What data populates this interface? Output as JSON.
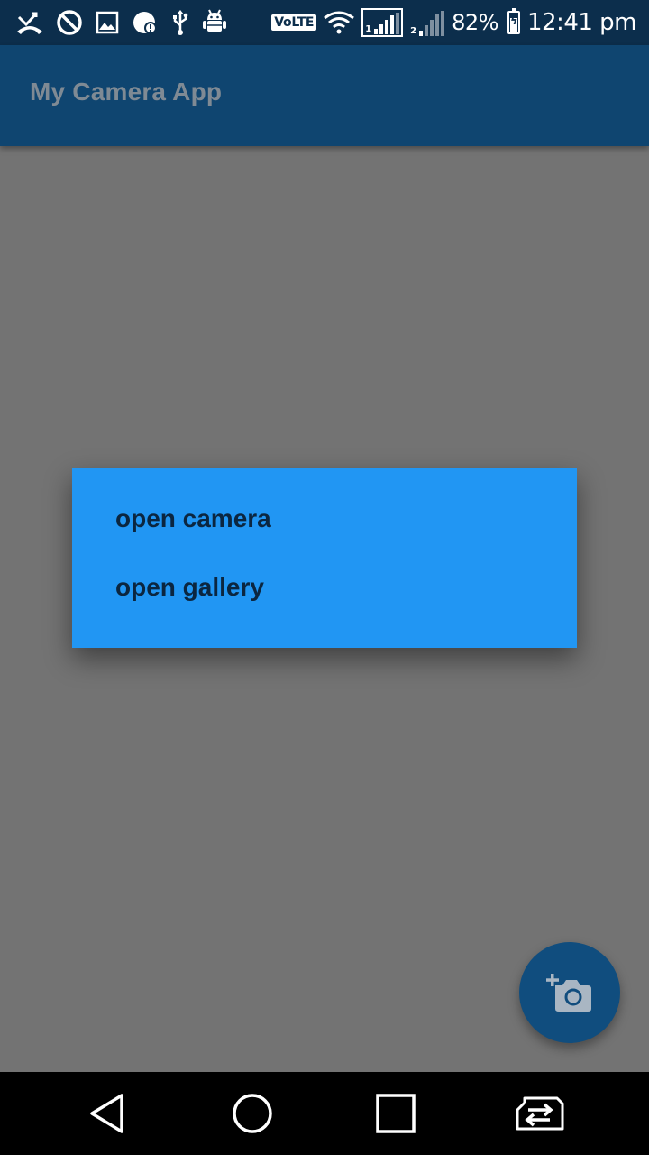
{
  "status_bar": {
    "icons_left": [
      "missed-call-icon",
      "do-not-disturb-icon",
      "image-icon",
      "data-saver-icon",
      "usb-icon",
      "android-debug-icon"
    ],
    "volte": "VoLTE",
    "sim1_number": "1",
    "sim2_number": "2",
    "battery_percent": "82%",
    "time": "12:41 pm"
  },
  "app_bar": {
    "title": "My Camera App"
  },
  "dialog": {
    "options": [
      {
        "label": "open camera"
      },
      {
        "label": "open gallery"
      }
    ]
  },
  "fab": {
    "icon": "add-a-photo-icon"
  },
  "nav_bar": {
    "buttons": [
      "back-icon",
      "home-icon",
      "recents-icon",
      "sim-switch-icon"
    ]
  },
  "colors": {
    "status_bar": "#0c2e4c",
    "app_bar": "#0f4570",
    "scrim_background": "#737373",
    "dialog": "#2196f3",
    "dialog_text": "#0b2640",
    "fab": "#104d7e"
  }
}
